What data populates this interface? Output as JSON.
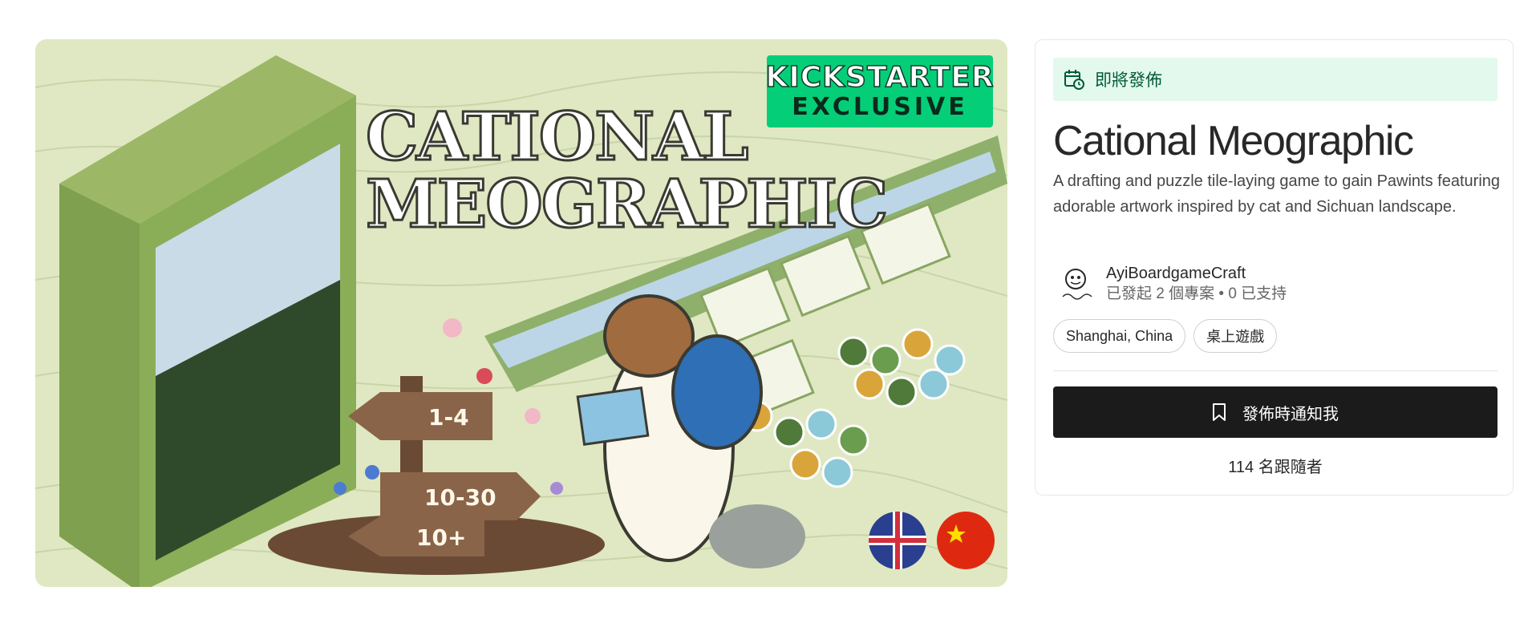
{
  "hero": {
    "badge_top": "KICKSTARTER",
    "badge_bottom": "EXCLUSIVE",
    "logo_line1": "CATIONAL",
    "logo_line2": "MEOGRAPHIC",
    "sign_players": "1-4",
    "sign_time": "10-30",
    "sign_age": "10+"
  },
  "project": {
    "status": "即將發佈",
    "title": "Cational Meographic",
    "description": "A drafting and puzzle tile-laying game to gain Pawints featuring adorable artwork inspired by cat and Sichuan landscape.",
    "creator": {
      "name": "AyiBoardgameCraft",
      "meta": "已發起 2 個專案 • 0 已支持"
    },
    "tags": [
      "Shanghai, China",
      "桌上遊戲"
    ],
    "notify_label": "發佈時通知我",
    "followers": "114 名跟隨者"
  },
  "colors": {
    "status_bg": "#e3f9ee",
    "status_text": "#025a35",
    "button_bg": "#1b1b1b",
    "kickstarter_green": "#05ce78"
  }
}
